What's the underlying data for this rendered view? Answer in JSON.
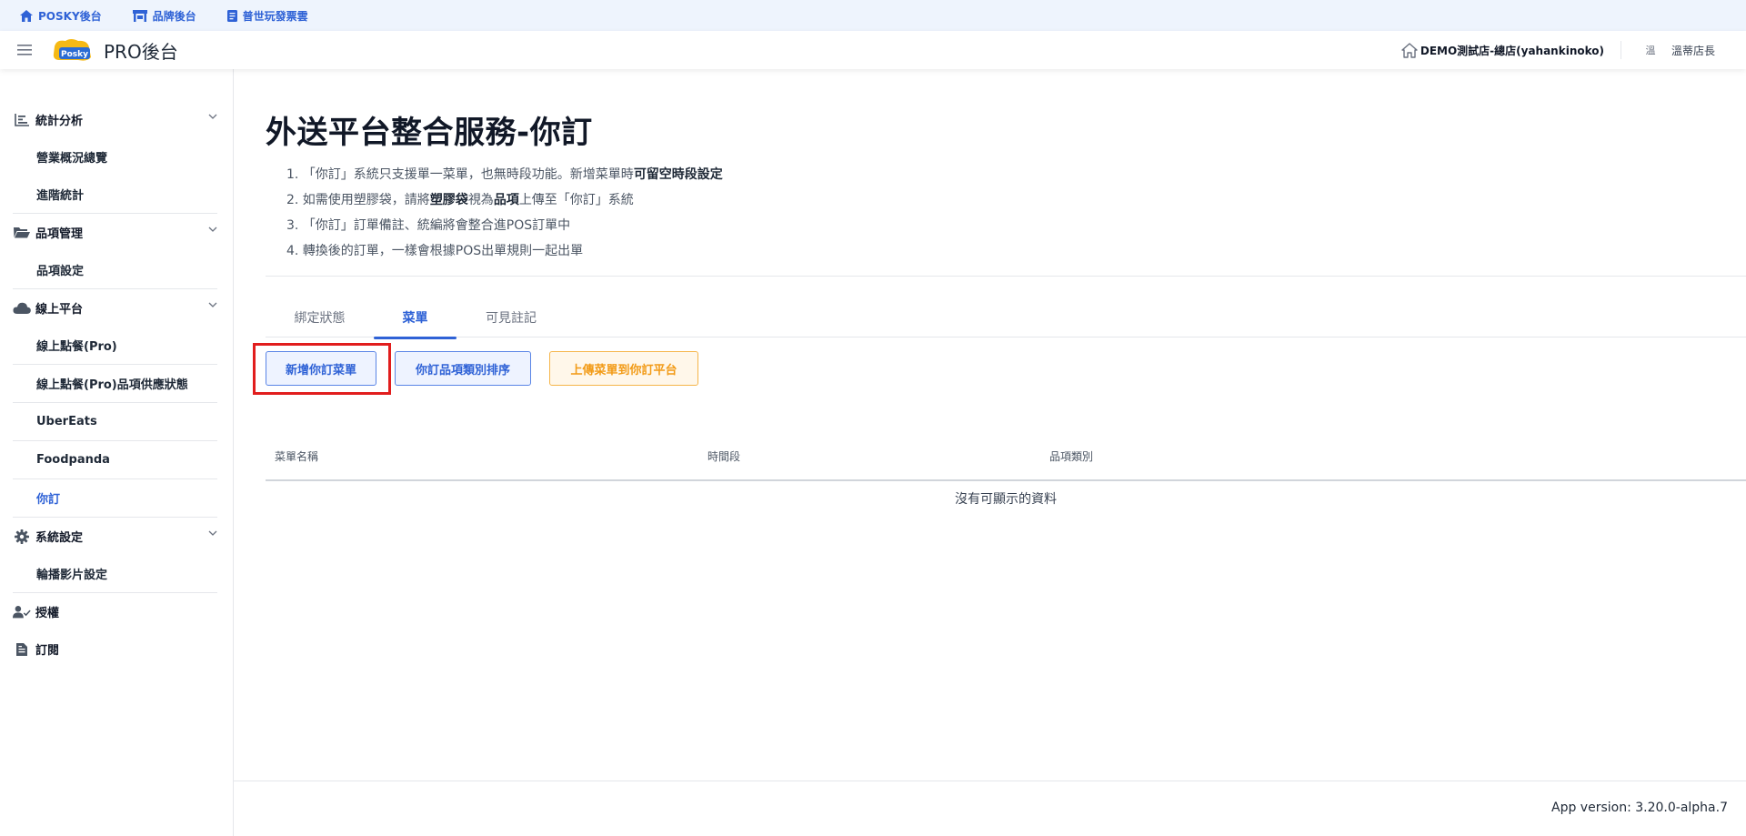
{
  "topbar": {
    "links": [
      {
        "label": "POSKY後台",
        "icon": "home-icon"
      },
      {
        "label": "品牌後台",
        "icon": "store-icon"
      },
      {
        "label": "普世玩發票雲",
        "icon": "document-icon"
      }
    ]
  },
  "header": {
    "logo_text": "Posky",
    "app_title": "PRO後台",
    "store_name": "DEMO測試店-總店(yahankinoko)",
    "user_avatar": "溫",
    "user_name": "溫蒂店長"
  },
  "sidebar": {
    "groups": [
      {
        "label": "統計分析",
        "icon": "chart-icon",
        "items": [
          "營業概況總覽",
          "進階統計"
        ]
      },
      {
        "label": "品項管理",
        "icon": "folder-icon",
        "items": [
          "品項設定"
        ]
      },
      {
        "label": "線上平台",
        "icon": "cloud-icon",
        "items": [
          "線上點餐(Pro)",
          "線上點餐(Pro)品項供應狀態",
          "UberEats",
          "Foodpanda",
          "你訂"
        ]
      },
      {
        "label": "系統設定",
        "icon": "gear-icon",
        "items": [
          "輪播影片設定"
        ]
      },
      {
        "label": "授權",
        "icon": "user-check-icon",
        "items": []
      },
      {
        "label": "訂閱",
        "icon": "receipt-icon",
        "items": []
      }
    ],
    "active_item": "你訂"
  },
  "main": {
    "title": "外送平台整合服務-你訂",
    "notes": [
      {
        "pre": "1. 「你訂」系統只支援單一菜單，也無時段功能。新增菜單時",
        "bold": "可留空時段設定",
        "mid": "",
        "bold2": "",
        "post": ""
      },
      {
        "pre": "2. 如需使用塑膠袋，請將",
        "bold": "塑膠袋",
        "mid": "視為",
        "bold2": "品項",
        "post": "上傳至「你訂」系統"
      },
      {
        "pre": "3. 「你訂」訂單備註、統編將會整合進POS訂單中",
        "bold": "",
        "mid": "",
        "bold2": "",
        "post": ""
      },
      {
        "pre": "4. 轉換後的訂單，一樣會根據POS出單規則一起出單",
        "bold": "",
        "mid": "",
        "bold2": "",
        "post": ""
      }
    ],
    "tabs": [
      "綁定狀態",
      "菜單",
      "可見註記"
    ],
    "active_tab": "菜單",
    "buttons": {
      "add_menu": "新增你訂菜單",
      "sort_categories": "你訂品項類別排序",
      "upload_menu": "上傳菜單到你訂平台"
    },
    "table": {
      "columns": [
        "菜單名稱",
        "時間段",
        "品項類別"
      ],
      "empty_text": "沒有可顯示的資料"
    }
  },
  "footer": {
    "version": "App version: 3.20.0-alpha.7"
  },
  "colors": {
    "accent": "#2f62d6",
    "warning": "#f29b17",
    "highlight": "#e11d1d"
  }
}
